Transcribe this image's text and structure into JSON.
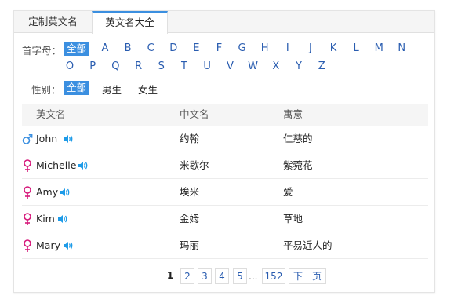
{
  "tabs": [
    {
      "label": "定制英文名"
    },
    {
      "label": "英文名大全"
    }
  ],
  "filters": {
    "initial_label": "首字母：",
    "all_label": "全部",
    "letters_row1": [
      "A",
      "B",
      "C",
      "D",
      "E",
      "F",
      "G",
      "H",
      "I",
      "J",
      "K",
      "L",
      "M",
      "N"
    ],
    "letters_row2": [
      "O",
      "P",
      "Q",
      "R",
      "S",
      "T",
      "U",
      "V",
      "W",
      "X",
      "Y",
      "Z"
    ],
    "gender_label": "性别：",
    "gender_all": "全部",
    "gender_male": "男生",
    "gender_female": "女生"
  },
  "table": {
    "headers": [
      "英文名",
      "中文名",
      "寓意"
    ],
    "rows": [
      {
        "gender_icon": "male-symbol",
        "english": "John",
        "chinese": "约翰",
        "meaning": "仁慈的"
      },
      {
        "gender_icon": "female-symbol",
        "english": "Michelle",
        "chinese": "米歇尔",
        "meaning": "紫菀花"
      },
      {
        "gender_icon": "female-symbol",
        "english": "Amy",
        "chinese": "埃米",
        "meaning": "爱"
      },
      {
        "gender_icon": "female-symbol",
        "english": "Kim",
        "chinese": "金姆",
        "meaning": "草地"
      },
      {
        "gender_icon": "female-symbol",
        "english": "Mary",
        "chinese": "玛丽",
        "meaning": "平易近人的"
      }
    ]
  },
  "pagination": {
    "current": "1",
    "pages": [
      "2",
      "3",
      "4",
      "5"
    ],
    "ellipsis": "...",
    "last": "152",
    "next": "下一页"
  },
  "colors": {
    "accent": "#3b8fe0",
    "male": "#3b8fe0",
    "female": "#d6177a",
    "speaker": "#1e9be8",
    "link": "#2a5db0"
  }
}
